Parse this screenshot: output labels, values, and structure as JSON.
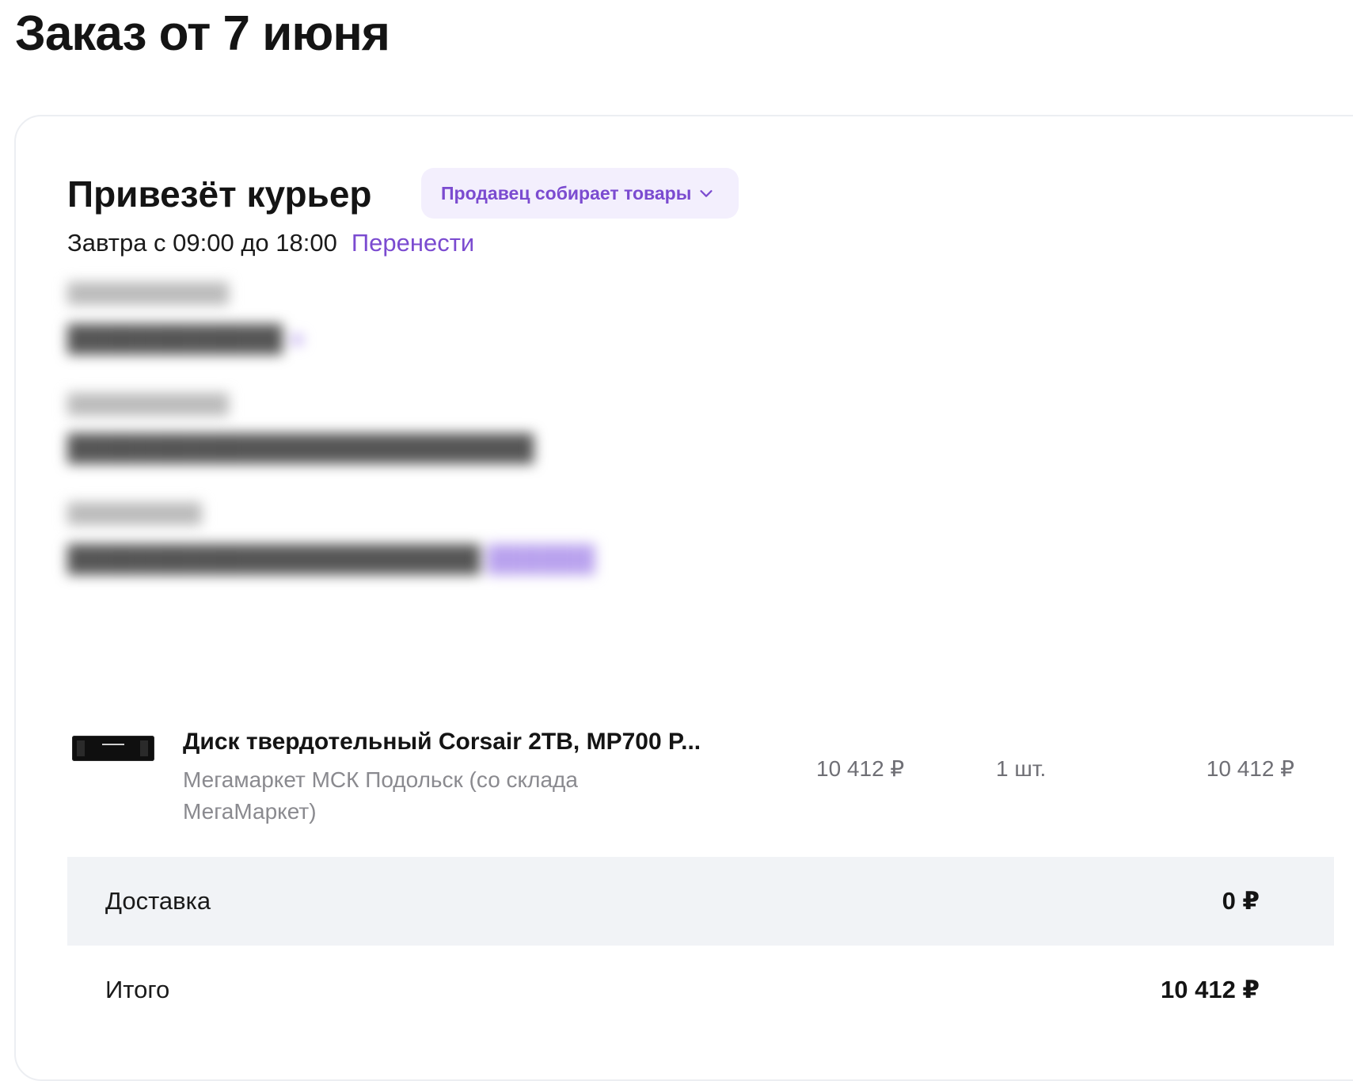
{
  "page": {
    "title": "Заказ от 7 июня"
  },
  "delivery": {
    "title": "Привезёт курьер",
    "status": "Продавец собирает товары",
    "time": "Завтра с 09:00 до 18:00",
    "reschedule": "Перенести"
  },
  "item": {
    "title": "Диск твердотельный Corsair 2TB, MP700 P...",
    "seller": "Мегамаркет МСК Подольск (со склада МегаМаркет)",
    "unit_price": "10 412 ₽",
    "quantity": "1 шт.",
    "total": "10 412 ₽"
  },
  "summary": {
    "delivery_label": "Доставка",
    "delivery_value": "0 ₽",
    "total_label": "Итого",
    "total_value": "10 412 ₽"
  },
  "colors": {
    "accent": "#7b4bd0",
    "pill_bg": "#f3effd",
    "summary_bg": "#f1f3f6"
  }
}
